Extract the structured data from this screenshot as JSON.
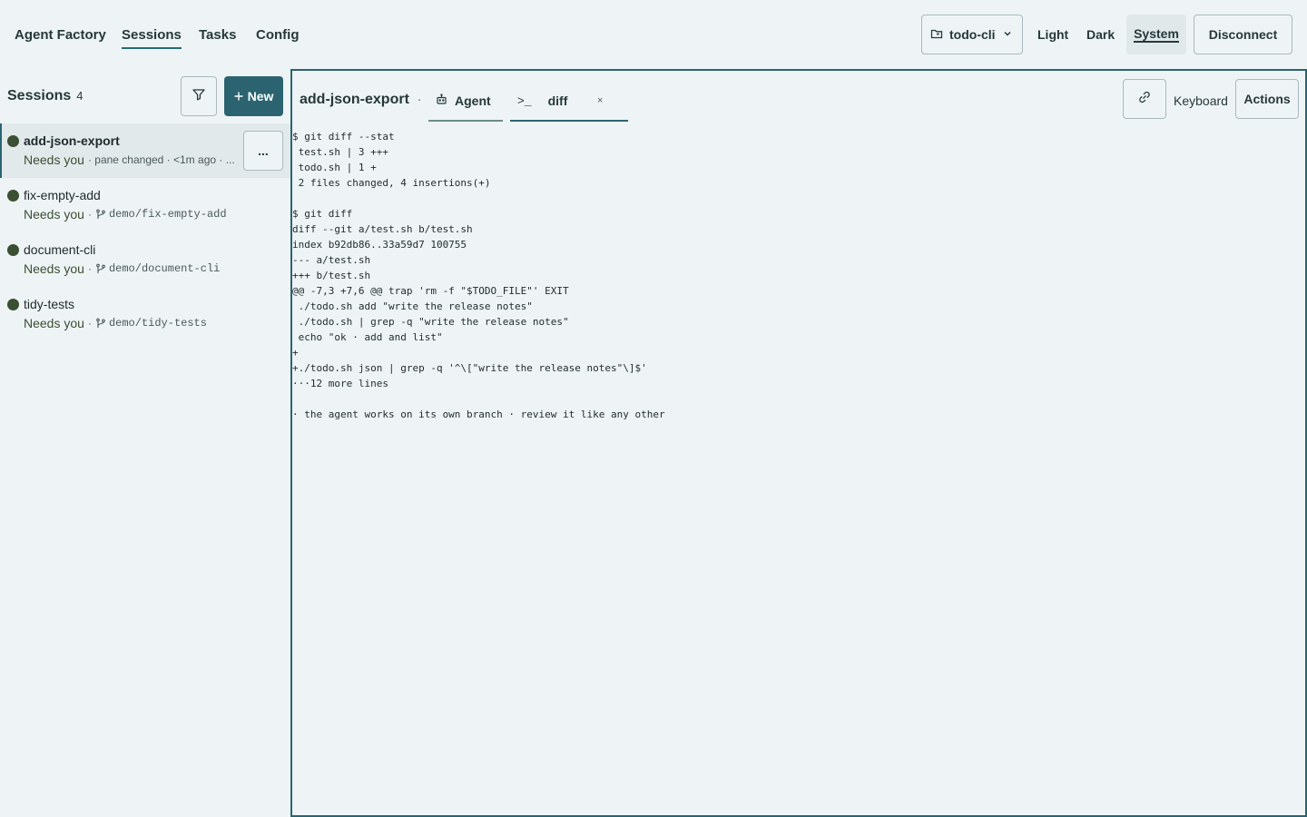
{
  "nav": {
    "app_title": "Agent Factory",
    "tabs": [
      {
        "label": "Sessions",
        "active": true
      },
      {
        "label": "Tasks",
        "active": false
      },
      {
        "label": "Config",
        "active": false
      }
    ]
  },
  "header": {
    "project": "todo-cli",
    "theme_options": [
      "Light",
      "Dark",
      "System"
    ],
    "active_theme": "System",
    "disconnect_label": "Disconnect"
  },
  "sidebar": {
    "title": "Sessions",
    "count": "4",
    "new_label": "New",
    "more_label": "...",
    "items": [
      {
        "name": "add-json-export",
        "status": "Needs you",
        "detail": "· pane changed · <1m ago · ...",
        "branch": "",
        "selected": true
      },
      {
        "name": "fix-empty-add",
        "status": "Needs you",
        "detail": "·",
        "branch": "demo/fix-empty-add",
        "selected": false
      },
      {
        "name": "document-cli",
        "status": "Needs you",
        "detail": "·",
        "branch": "demo/document-cli",
        "selected": false
      },
      {
        "name": "tidy-tests",
        "status": "Needs you",
        "detail": "·",
        "branch": "demo/tidy-tests",
        "selected": false
      }
    ]
  },
  "main": {
    "session_title": "add-json-export",
    "title_separator": "·",
    "tabs": [
      {
        "label": "Agent",
        "icon": "robot-icon"
      },
      {
        "label": "diff",
        "icon": "terminal-prompt-icon",
        "closable": true
      }
    ],
    "close_glyph": "×",
    "keyboard_label": "Keyboard",
    "actions_label": "Actions",
    "terminal_lines": [
      "$ git diff --stat",
      " test.sh | 3 +++",
      " todo.sh | 1 +",
      " 2 files changed, 4 insertions(+)",
      "",
      "$ git diff",
      "diff --git a/test.sh b/test.sh",
      "index b92db86..33a59d7 100755",
      "--- a/test.sh",
      "+++ b/test.sh",
      "@@ -7,3 +7,6 @@ trap 'rm -f \"$TODO_FILE\"' EXIT",
      " ./todo.sh add \"write the release notes\"",
      " ./todo.sh | grep -q \"write the release notes\"",
      " echo \"ok · add and list\"",
      "+",
      "+./todo.sh json | grep -q '^\\[\"write the release notes\"\\]$'",
      "···12 more lines",
      "",
      "· the agent works on its own branch · review it like any other"
    ]
  },
  "colors": {
    "accent": "#2b6470",
    "background": "#eef4f6",
    "status_dot": "#3a4f33"
  }
}
